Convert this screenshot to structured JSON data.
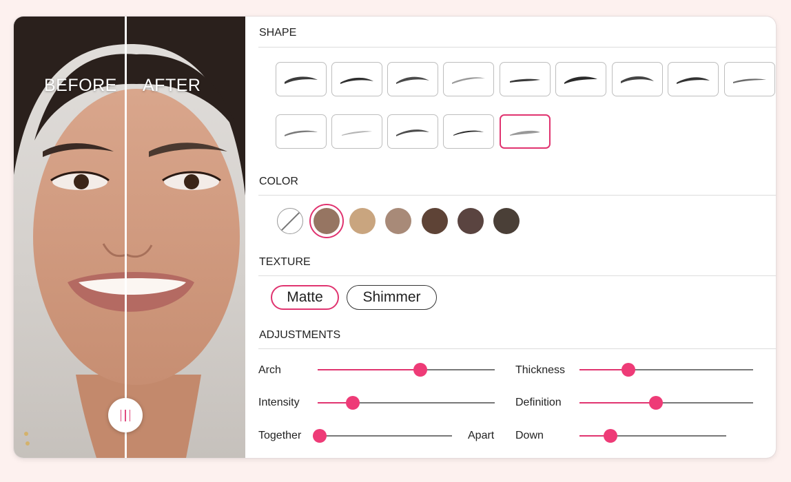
{
  "photo": {
    "before_label": "BEFORE",
    "after_label": "AFTER",
    "handle_icon": "drag-handle-icon"
  },
  "sections": {
    "shape": "SHAPE",
    "color": "COLOR",
    "texture": "TEXTURE",
    "adjustments": "ADJUSTMENTS"
  },
  "shapes": {
    "count": 14,
    "selected_index": 13
  },
  "colors": {
    "none_icon": "no-color-icon",
    "swatches": [
      "#967562",
      "#c9a57f",
      "#a88a78",
      "#5e4336",
      "#5a4440",
      "#4a3f37"
    ],
    "selected_index": 0,
    "accent": "#e0336f"
  },
  "texture": {
    "options": [
      "Matte",
      "Shimmer"
    ],
    "selected": "Matte"
  },
  "adjustments": {
    "arch": {
      "label": "Arch",
      "value": 0.58
    },
    "thickness": {
      "label": "Thickness",
      "value": 0.28
    },
    "intensity": {
      "label": "Intensity",
      "value": 0.2
    },
    "definition": {
      "label": "Definition",
      "value": 0.44
    },
    "together": {
      "label": "Together",
      "end_label": "Apart",
      "value": 0.0
    },
    "down": {
      "label": "Down",
      "value": 0.21
    }
  }
}
